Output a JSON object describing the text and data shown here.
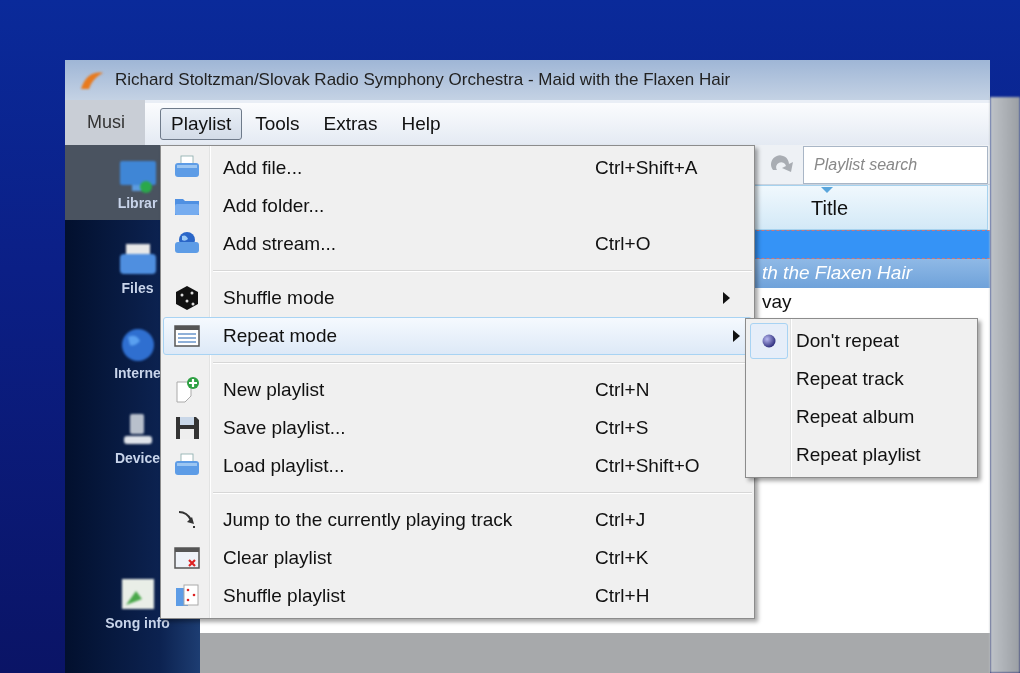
{
  "window": {
    "title": "Richard Stoltzman/Slovak Radio Symphony Orchestra - Maid with the Flaxen Hair",
    "menu_label": "Musi"
  },
  "menubar": [
    {
      "label": "Playlist",
      "selected": true
    },
    {
      "label": "Tools",
      "selected": false
    },
    {
      "label": "Extras",
      "selected": false
    },
    {
      "label": "Help",
      "selected": false
    }
  ],
  "sidebar": {
    "items": [
      {
        "label": "Librar",
        "kind": "library",
        "selected": true
      },
      {
        "label": "Files",
        "kind": "files",
        "selected": false
      },
      {
        "label": "Interne",
        "kind": "internet",
        "selected": false
      },
      {
        "label": "Device",
        "kind": "devices",
        "selected": false
      },
      {
        "label": "Song info",
        "kind": "songinfo",
        "selected": false
      }
    ]
  },
  "toolbar": {
    "search": {
      "placeholder": "Playlist search"
    }
  },
  "playlist": {
    "columns": [
      "Title"
    ],
    "rows": [
      {
        "selected": true,
        "playing": false
      },
      {
        "title": "th the Flaxen Hair",
        "selected": false,
        "playing": true
      },
      {
        "title": "vay",
        "selected": false,
        "playing": false
      }
    ]
  },
  "menu": {
    "items": [
      {
        "kind": "item",
        "label": "Add file...",
        "shortcut": "Ctrl+Shift+A",
        "selected": false
      },
      {
        "kind": "item",
        "label": "Add folder...",
        "selected": false
      },
      {
        "kind": "item",
        "label": "Add stream...",
        "shortcut": "Ctrl+O",
        "selected": false
      },
      {
        "kind": "separator"
      },
      {
        "kind": "submenu",
        "label": "Shuffle mode",
        "selected": false
      },
      {
        "kind": "submenu",
        "label": "Repeat mode",
        "selected": true
      },
      {
        "kind": "separator"
      },
      {
        "kind": "item",
        "label": "New playlist",
        "shortcut": "Ctrl+N",
        "selected": false
      },
      {
        "kind": "item",
        "label": "Save playlist...",
        "shortcut": "Ctrl+S",
        "selected": false
      },
      {
        "kind": "item",
        "label": "Load playlist...",
        "shortcut": "Ctrl+Shift+O",
        "selected": false
      },
      {
        "kind": "separator"
      },
      {
        "kind": "item",
        "label": "Jump to the currently playing track",
        "shortcut": "Ctrl+J",
        "selected": false
      },
      {
        "kind": "item",
        "label": "Clear playlist",
        "shortcut": "Ctrl+K",
        "selected": false
      },
      {
        "kind": "item",
        "label": "Shuffle playlist",
        "shortcut": "Ctrl+H",
        "selected": false
      }
    ]
  },
  "submenu": {
    "items": [
      {
        "label": "Don't repeat",
        "checked": true
      },
      {
        "label": "Repeat track",
        "checked": false
      },
      {
        "label": "Repeat album",
        "checked": false
      },
      {
        "label": "Repeat playlist",
        "checked": false
      }
    ]
  }
}
